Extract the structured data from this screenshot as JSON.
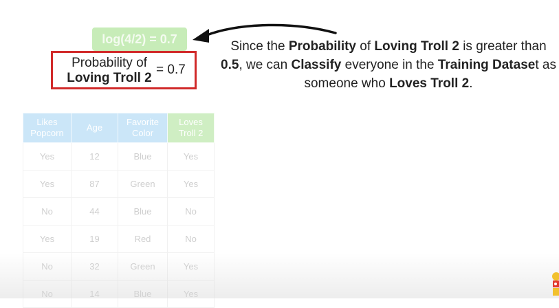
{
  "badge": {
    "text": "log(4/2) = 0.7"
  },
  "probability_box": {
    "label_line1": "Probability of",
    "label_line2": "Loving Troll 2",
    "equals_text": "= 0.7"
  },
  "explanation": {
    "s1": "Since the ",
    "s2": "Probability",
    "s3": " of ",
    "s4": "Loving Troll 2",
    "s5": " is greater than ",
    "s6": "0.5",
    "s7": ", we can ",
    "s8": "Classify",
    "s9": " everyone in the ",
    "s10": "Training Datase",
    "s11": "t as someone who ",
    "s12": "Loves Troll 2",
    "s13": "."
  },
  "table": {
    "headers": [
      {
        "line1": "Likes",
        "line2": "Popcorn"
      },
      {
        "line1": "Age",
        "line2": ""
      },
      {
        "line1": "Favorite",
        "line2": "Color"
      },
      {
        "line1": "Loves",
        "line2": "Troll 2"
      }
    ],
    "rows": [
      [
        "Yes",
        "12",
        "Blue",
        "Yes"
      ],
      [
        "Yes",
        "87",
        "Green",
        "Yes"
      ],
      [
        "No",
        "44",
        "Blue",
        "No"
      ],
      [
        "Yes",
        "19",
        "Red",
        "No"
      ],
      [
        "No",
        "32",
        "Green",
        "Yes"
      ],
      [
        "No",
        "14",
        "Blue",
        "Yes"
      ]
    ]
  },
  "colors": {
    "highlight_border": "#d12a2a",
    "badge_green": "#c7ecb8",
    "header_blue": "#cbe6f8",
    "header_green": "#cfeec3"
  },
  "icons": {
    "arrow": "curved-arrow-icon",
    "logo": "channel-logo-icon"
  }
}
